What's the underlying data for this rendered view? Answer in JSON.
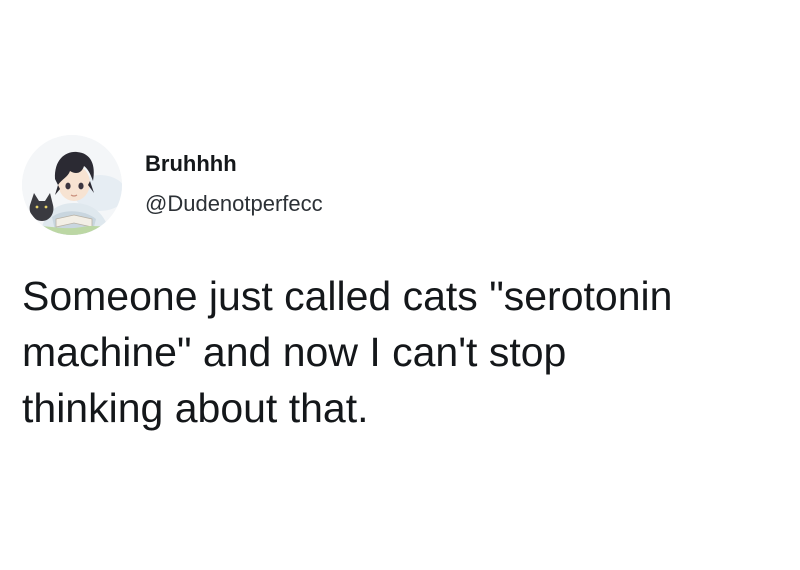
{
  "tweet": {
    "display_name": "Bruhhhh",
    "handle": "@Dudenotperfecc",
    "text": "Someone just called cats \"serotonin\nmachine\" and now I can't stop\nthinking about that.",
    "avatar_icon": "anime-boy-with-cat-avatar"
  },
  "colors": {
    "text": "#14171a",
    "handle": "#2c3136",
    "background": "#ffffff"
  }
}
